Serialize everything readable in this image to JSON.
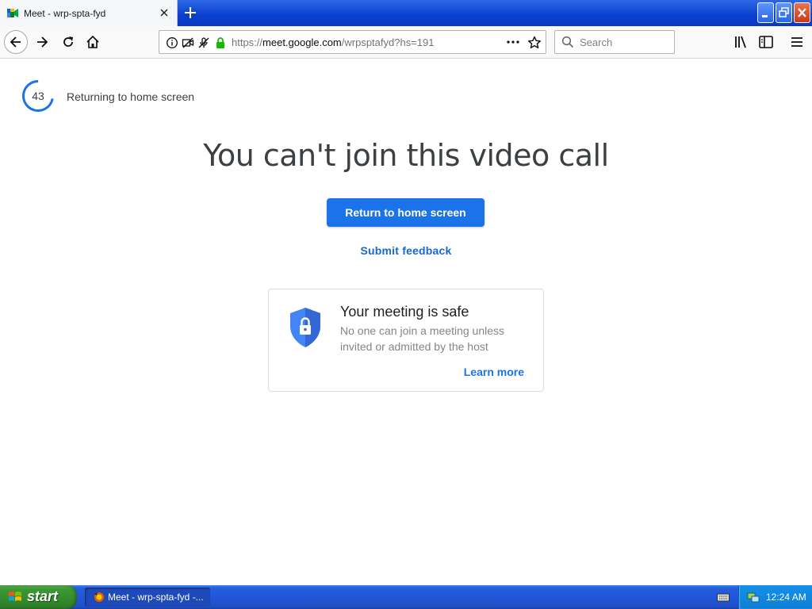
{
  "browser": {
    "tab_title": "Meet - wrp-spta-fyd",
    "url_prefix": "https://",
    "url_host": "meet.google.com",
    "url_path": "/wrpsptafyd?hs=191",
    "search_placeholder": "Search"
  },
  "page": {
    "countdown": "43",
    "countdown_progress": 0.72,
    "returning_text": "Returning to home screen",
    "headline": "You can't join this video call",
    "return_button": "Return to home screen",
    "feedback_link": "Submit feedback",
    "safe_title": "Your meeting is safe",
    "safe_desc": "No one can join a meeting unless invited or admitted by the host",
    "learn_more": "Learn more"
  },
  "taskbar": {
    "start_label": "start",
    "task_label": "Meet - wrp-spta-fyd -...",
    "clock": "12:24 AM"
  },
  "colors": {
    "accent": "#1a73e8",
    "titlebar": "#0a3fcf",
    "start_green": "#3c9a34"
  }
}
